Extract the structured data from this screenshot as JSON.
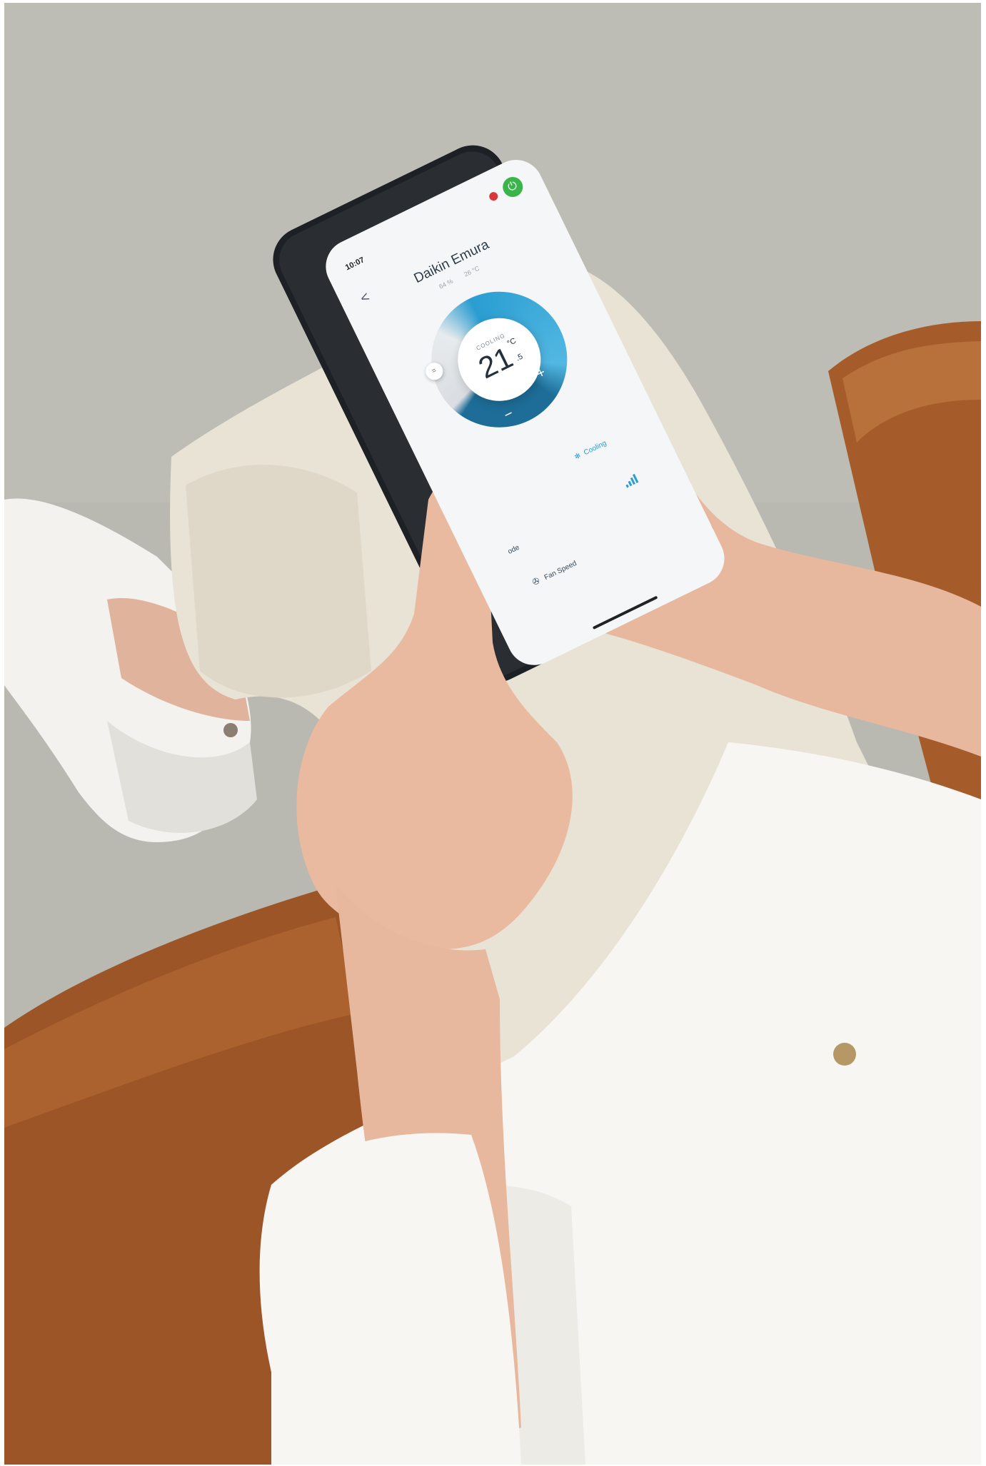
{
  "phone": {
    "status_time": "10:07",
    "back_glyph": "<",
    "device_name": "Daikin Emura",
    "sub_left": "64 %",
    "sub_right": "26 °C",
    "power_icon": "power-icon",
    "alert_icon": "notification-icon"
  },
  "thermostat": {
    "mode": "COOLING",
    "temp_int": "21",
    "temp_unit": "°C",
    "temp_dec": ".5",
    "minus": "−",
    "plus": "+",
    "knob": "="
  },
  "controls": {
    "mode_label": "Cooling",
    "mode_icon": "snowflake-icon",
    "mode_cut": "ode",
    "fan_label": "Fan Speed",
    "fan_icon": "fan-icon",
    "fan_level_icon": "signal-bars-icon"
  },
  "colors": {
    "accent_blue": "#2a9dd1",
    "dark_blue": "#1d6d98",
    "power_green": "#39b54a"
  }
}
